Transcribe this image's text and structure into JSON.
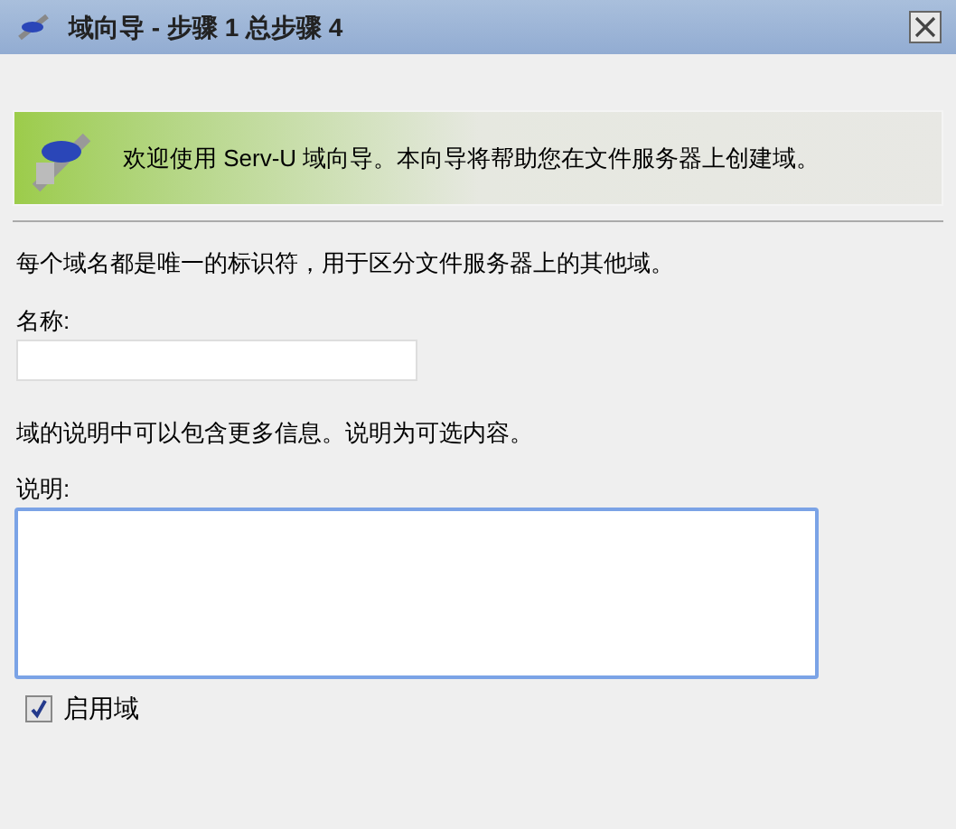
{
  "window": {
    "title": "域向导 - 步骤 1 总步骤 4"
  },
  "banner": {
    "text": "欢迎使用 Serv-U 域向导。本向导将帮助您在文件服务器上创建域。"
  },
  "intro": "每个域名都是唯一的标识符，用于区分文件服务器上的其他域。",
  "name_field": {
    "label": "名称:"
  },
  "description_hint": "域的说明中可以包含更多信息。说明为可选内容。",
  "description_field": {
    "label": "说明:"
  },
  "enable": {
    "label": "启用域",
    "checked": true
  }
}
